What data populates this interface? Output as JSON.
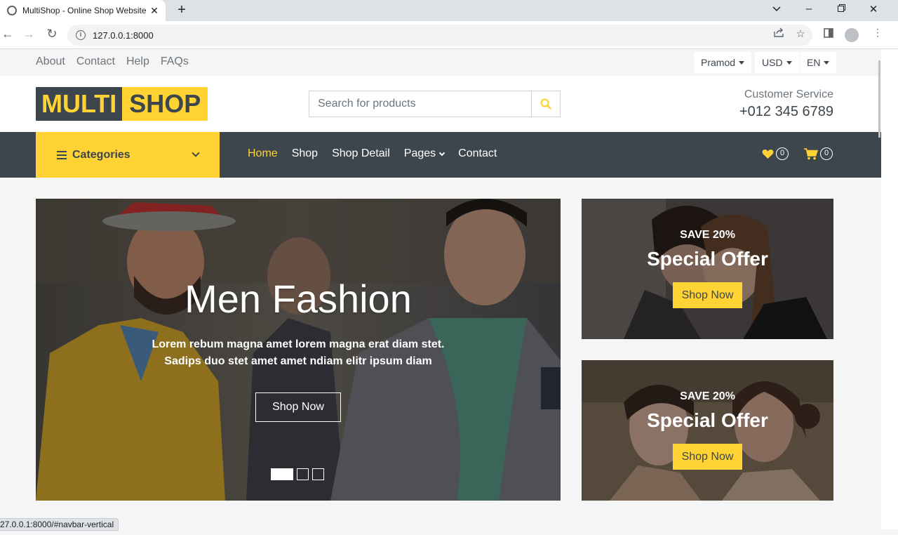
{
  "browser": {
    "tab_title": "MultiShop - Online Shop Website",
    "url": "127.0.0.1:8000",
    "status_url": "27.0.0.1:8000/#navbar-vertical"
  },
  "topbar": {
    "links": [
      "About",
      "Contact",
      "Help",
      "FAQs"
    ],
    "user_label": "Pramod",
    "currency_label": "USD",
    "language_label": "EN"
  },
  "header": {
    "logo_part1": "MULTI",
    "logo_part2": "SHOP",
    "search_placeholder": "Search for products",
    "cs_label": "Customer Service",
    "cs_phone": "+012 345 6789"
  },
  "navbar": {
    "categories_label": "Categories",
    "menu": {
      "home": "Home",
      "shop": "Shop",
      "shop_detail": "Shop Detail",
      "pages": "Pages",
      "contact": "Contact"
    },
    "wishlist_count": "0",
    "cart_count": "0"
  },
  "carousel": {
    "title": "Men Fashion",
    "text": "Lorem rebum magna amet lorem magna erat diam stet. Sadips duo stet amet amet ndiam elitr ipsum diam",
    "button": "Shop Now"
  },
  "offers": [
    {
      "save": "SAVE 20%",
      "title": "Special Offer",
      "button": "Shop Now"
    },
    {
      "save": "SAVE 20%",
      "title": "Special Offer",
      "button": "Shop Now"
    }
  ],
  "colors": {
    "primary": "#FFD333",
    "dark": "#3D464D",
    "light": "#F5F5F5"
  }
}
